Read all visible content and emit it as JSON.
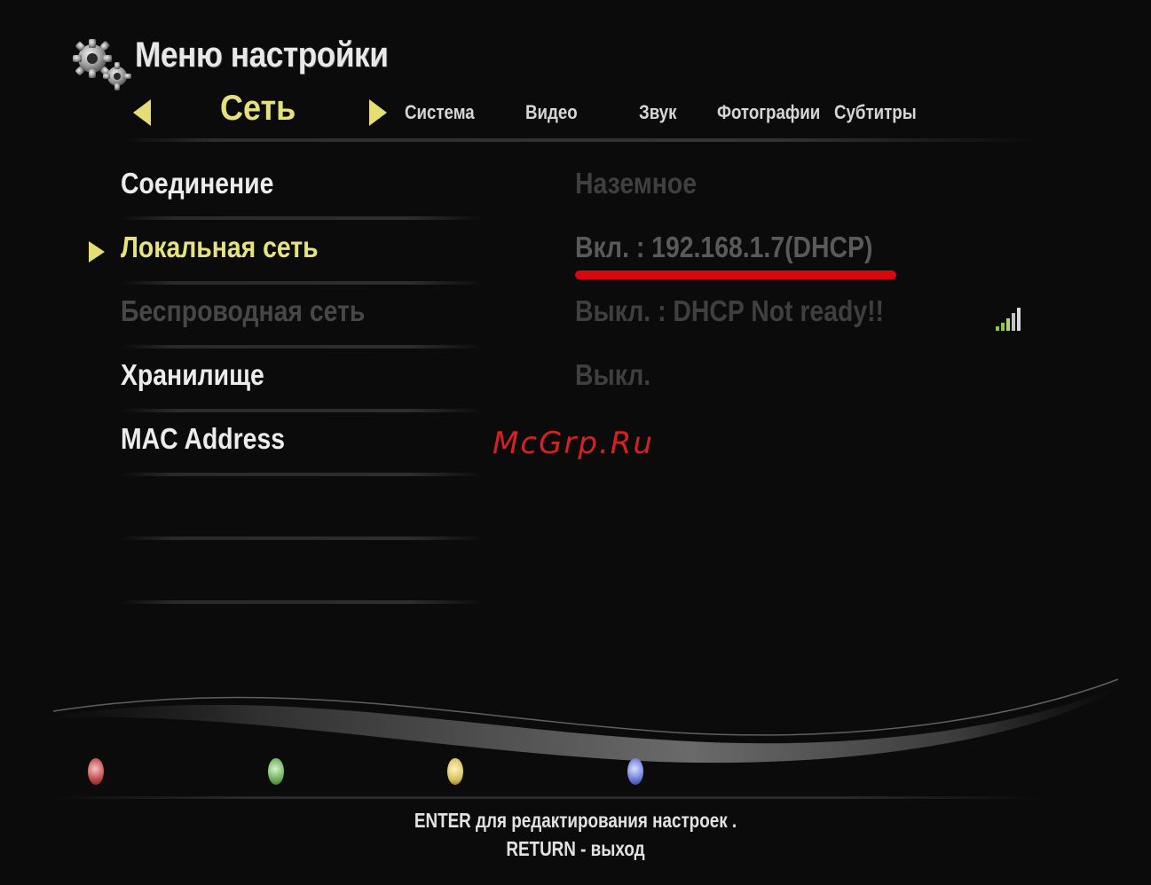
{
  "header": {
    "title": "Меню настройки",
    "current_tab": "Сеть",
    "tabs": [
      {
        "label": "Система"
      },
      {
        "label": "Видео"
      },
      {
        "label": "Звук"
      },
      {
        "label": "Фотографии"
      },
      {
        "label": "Субтитры"
      }
    ]
  },
  "settings": {
    "rows": [
      {
        "label": "Соединение",
        "value": "Наземное",
        "state": "normal"
      },
      {
        "label": "Локальная сеть",
        "value": "Вкл. : 192.168.1.7(DHCP)",
        "state": "selected"
      },
      {
        "label": "Беспроводная сеть",
        "value": "Выкл. : DHCP Not ready!!",
        "state": "disabled"
      },
      {
        "label": "Хранилище",
        "value": "Выкл.",
        "state": "normal"
      },
      {
        "label": "MAC Address",
        "value": "",
        "state": "normal"
      }
    ]
  },
  "icons": {
    "header": "gear-icon",
    "nav_left": "triangle-left-icon",
    "nav_right": "triangle-right-icon",
    "row_pointer": "triangle-right-icon",
    "wireless_signal": "signal-bars-icon"
  },
  "watermark": "McGrp.Ru",
  "footer": {
    "color_buttons": [
      "red",
      "green",
      "yellow",
      "blue"
    ],
    "hint_enter": "ENTER для редактирования настроек .",
    "hint_return": "RETURN - выход"
  },
  "colors": {
    "background": "#0b0b0b",
    "accent_yellow": "#e6e27e",
    "text": "#ececec",
    "disabled_text": "#474747",
    "highlight_red": "#d8080e"
  }
}
